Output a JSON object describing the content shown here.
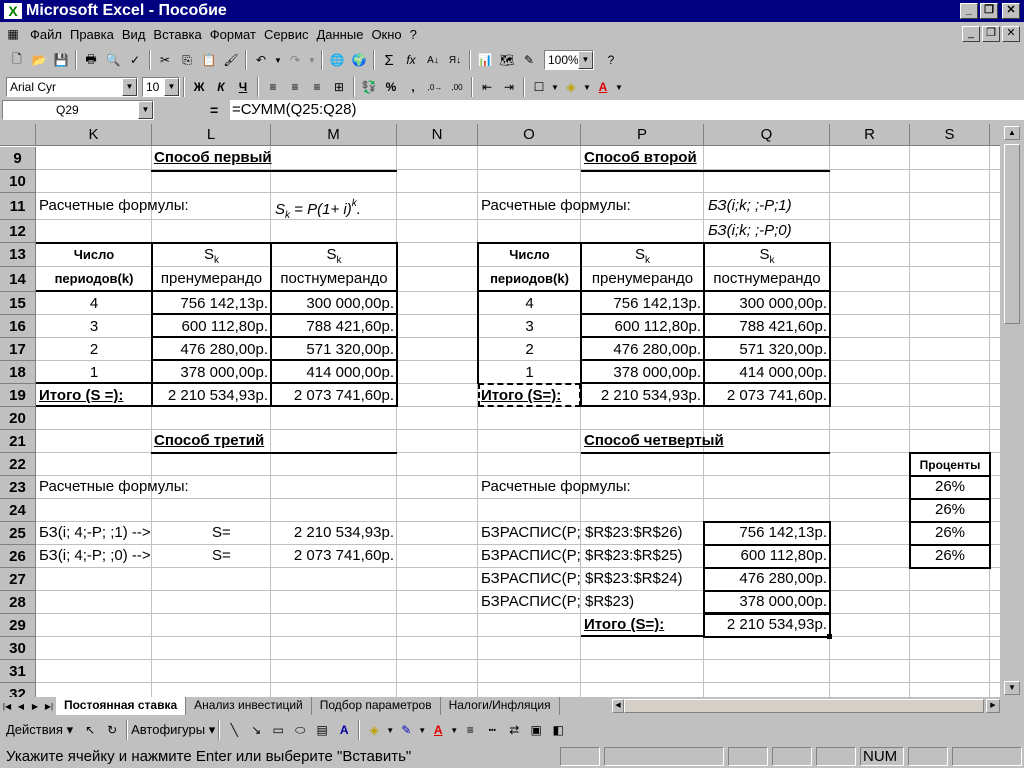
{
  "window": {
    "title": "Microsoft Excel - Пособие"
  },
  "menu": [
    "Файл",
    "Правка",
    "Вид",
    "Вставка",
    "Формат",
    "Сервис",
    "Данные",
    "Окно",
    "?"
  ],
  "toolbar": {
    "zoom": "100%",
    "font": "Arial Cyr",
    "size": "10"
  },
  "formula": {
    "name_box": "Q29",
    "equals": "=",
    "content": "=СУММ(Q25:Q28)"
  },
  "columns": [
    "K",
    "L",
    "M",
    "N",
    "O",
    "P",
    "Q",
    "R",
    "S"
  ],
  "rows": [
    "9",
    "10",
    "11",
    "12",
    "13",
    "14",
    "15",
    "16",
    "17",
    "18",
    "19",
    "20",
    "21",
    "22",
    "23",
    "24",
    "25",
    "26",
    "27",
    "28",
    "29",
    "30",
    "31",
    "32"
  ],
  "sheet": {
    "m1_title": "Способ первый",
    "m2_title": "Способ второй",
    "m3_title": "Способ третий",
    "m4_title": "Способ четвертый",
    "calc_formulas": "Расчетные формулы:",
    "f11_left": "S",
    "f11_left_sub": "k",
    "f11_mid": " = P(1+ i)",
    "f11_sup": "k",
    "f11_end": ".",
    "f11_right": "БЗ(i;k; ;-P;1)",
    "f12_right": "БЗ(i;k; ;-P;0)",
    "hdr_num": "Число",
    "hdr_periods": "периодов(k)",
    "hdr_s": "S",
    "hdr_s_sub": "k",
    "hdr_pre": "пренумерандо",
    "hdr_post": "постнумерандо",
    "table": [
      {
        "k": "4",
        "pre": "756 142,13р.",
        "post": "300 000,00р."
      },
      {
        "k": "3",
        "pre": "600 112,80р.",
        "post": "788 421,60р."
      },
      {
        "k": "2",
        "pre": "476 280,00р.",
        "post": "571 320,00р."
      },
      {
        "k": "1",
        "pre": "378 000,00р.",
        "post": "414 000,00р."
      }
    ],
    "total_left_label": "Итого (S =):",
    "total_right_label": "Итого (S=):",
    "total_pre": "2 210 534,93р.",
    "total_post": "2 073 741,60р.",
    "r25_formula": "БЗ(i; 4;-P; ;1)  -->",
    "r26_formula": "БЗ(i; 4;-P; ;0)  -->",
    "s_eq": "S=",
    "r25_val": "2 210 534,93р.",
    "r26_val": "2 073 741,60р.",
    "bz25": "БЗРАСПИС(P; $R$23:$R$26)",
    "bz26": "БЗРАСПИС(P; $R$23:$R$25)",
    "bz27": "БЗРАСПИС(P; $R$23:$R$24)",
    "bz28": "БЗРАСПИС(P; $R$23)",
    "q25": "756 142,13р.",
    "q26": "600 112,80р.",
    "q27": "476 280,00р.",
    "q28": "378 000,00р.",
    "total29_label": "Итого (S=):",
    "q29": "2 210 534,93р.",
    "pct_header": "Проценты",
    "pct": [
      "26%",
      "26%",
      "26%",
      "26%"
    ]
  },
  "tabs": [
    "Постоянная ставка",
    "Анализ инвестиций",
    "Подбор параметров",
    "Налоги/Инфляция"
  ],
  "drawing": {
    "actions": "Действия",
    "autoshapes": "Автофигуры"
  },
  "status": {
    "message": "Укажите ячейку и нажмите Enter или выберите \"Вставить\"",
    "num": "NUM"
  }
}
